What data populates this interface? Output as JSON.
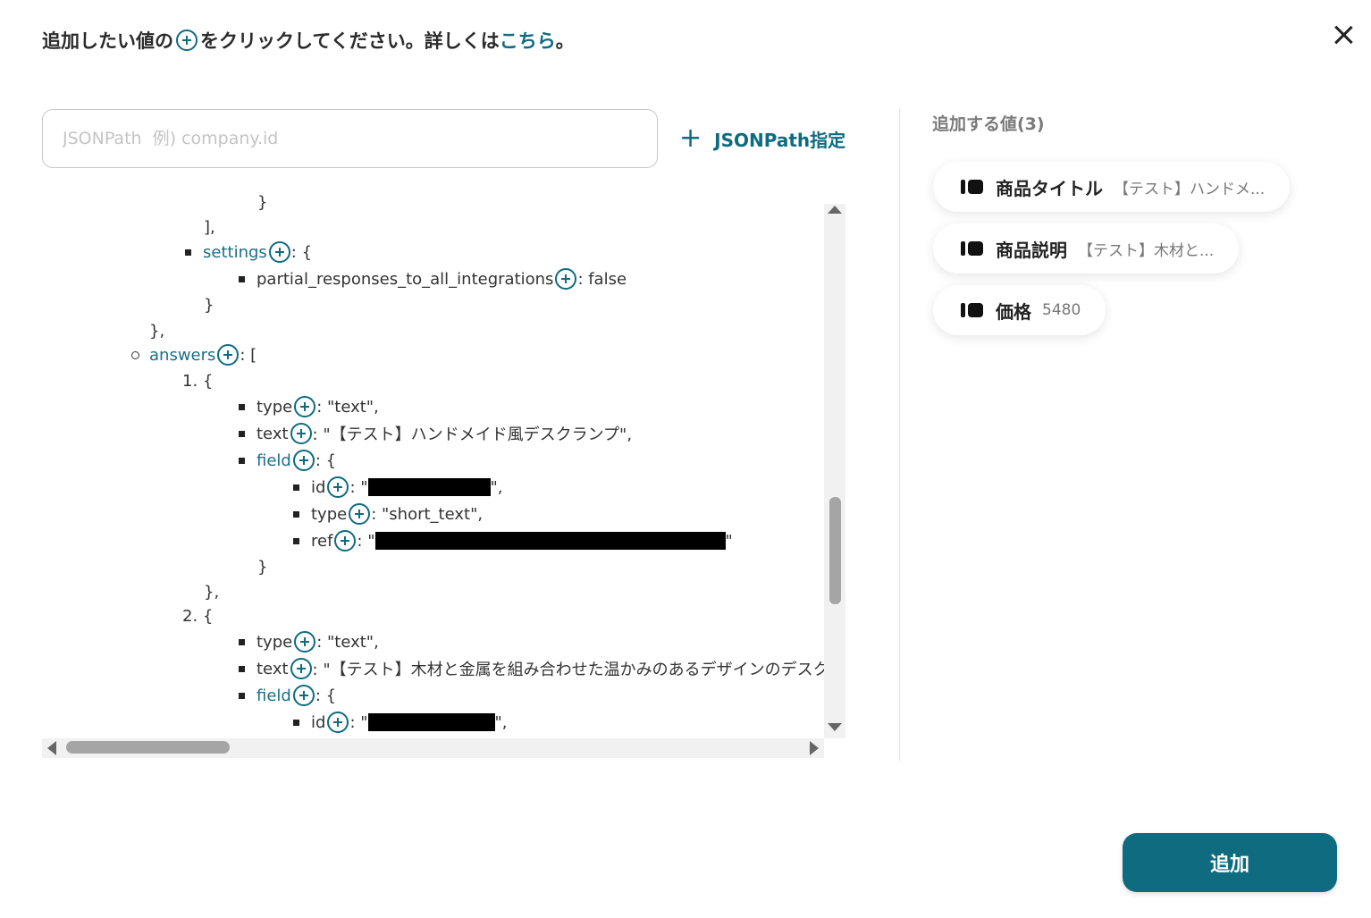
{
  "header": {
    "instruction_before": "追加したい値の",
    "instruction_after": "をクリックしてください。詳しくは",
    "link_text": "こちら",
    "period": "。"
  },
  "search": {
    "placeholder": "JSONPath  例) company.id",
    "value": ""
  },
  "jsonpath_button": {
    "plus": "+",
    "label": "JSONPath指定"
  },
  "tree": {
    "lines": [
      {
        "text": "}"
      },
      {
        "text": "],"
      },
      {
        "key": "settings",
        "suffix": ": {"
      },
      {
        "key": "partial_responses_to_all_integrations",
        "suffix": ": false"
      },
      {
        "text": "}"
      },
      {
        "text": "},"
      },
      {
        "key": "answers",
        "suffix": ": ["
      },
      {
        "text": "1. {"
      },
      {
        "key": "type",
        "suffix": ": \"text\","
      },
      {
        "key": "text",
        "suffix": ": \"【テスト】ハンドメイド風デスクランプ\","
      },
      {
        "key": "field",
        "suffix": ": {"
      },
      {
        "key": "id",
        "prefix": ": \"",
        "suffix": "\","
      },
      {
        "key": "type",
        "suffix": ": \"short_text\","
      },
      {
        "key": "ref",
        "prefix": ": \"",
        "suffix": "\""
      },
      {
        "text": "}"
      },
      {
        "text": "},"
      },
      {
        "text": "2. {"
      },
      {
        "key": "type",
        "suffix": ": \"text\","
      },
      {
        "key": "text",
        "suffix": ": \"【テスト】木材と金属を組み合わせた温かみのあるデザインのデスクランプ"
      },
      {
        "key": "field",
        "suffix": ": {"
      },
      {
        "key": "id",
        "prefix": ": \"",
        "suffix": "\","
      }
    ]
  },
  "selected": {
    "title": "追加する値(3)",
    "items": [
      {
        "name": "商品タイトル",
        "value": "【テスト】ハンドメ..."
      },
      {
        "name": "商品説明",
        "value": "【テスト】木材と..."
      },
      {
        "name": "価格",
        "value": "5480"
      }
    ]
  },
  "add_button": {
    "label": "追加"
  }
}
